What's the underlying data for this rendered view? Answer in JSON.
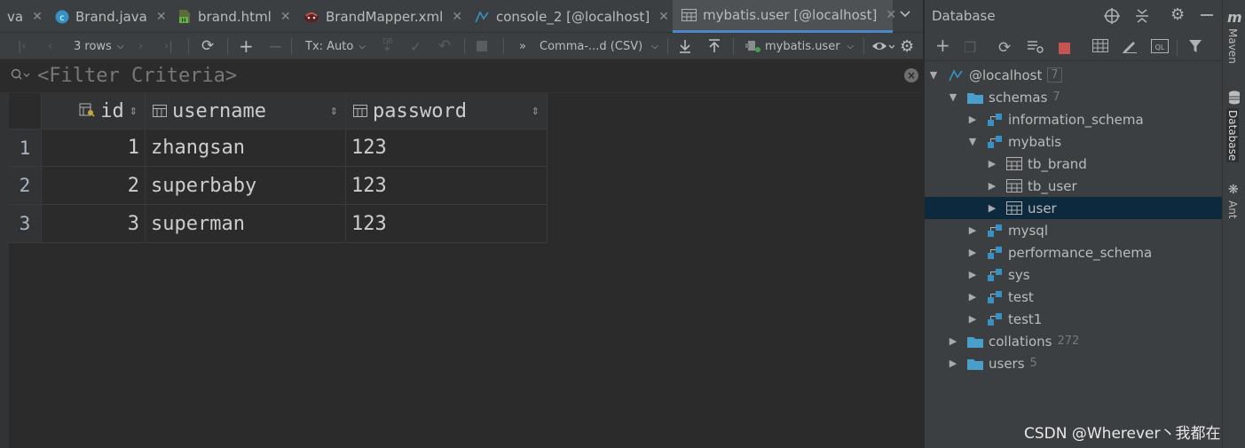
{
  "tabs": [
    {
      "label": "va",
      "icon": "java-class-icon"
    },
    {
      "label": "Brand.java",
      "icon": "java-class-icon"
    },
    {
      "label": "brand.html",
      "icon": "html-file-icon"
    },
    {
      "label": "BrandMapper.xml",
      "icon": "mybatis-xml-icon"
    },
    {
      "label": "console_2 [@localhost]",
      "icon": "sql-console-icon"
    },
    {
      "label": "mybatis.user [@localhost]",
      "icon": "table-icon",
      "active": true
    }
  ],
  "toolbar": {
    "rows": "3 rows",
    "tx": "Tx: Auto",
    "db_label": "DB",
    "export_format": "Comma-...d (CSV)",
    "datasource": "mybatis.user"
  },
  "filter": {
    "placeholder": "<Filter Criteria>"
  },
  "grid": {
    "columns": [
      "id",
      "username",
      "password"
    ],
    "rows": [
      {
        "n": "1",
        "id": "1",
        "username": "zhangsan",
        "password": "123"
      },
      {
        "n": "2",
        "id": "2",
        "username": "superbaby",
        "password": "123"
      },
      {
        "n": "3",
        "id": "3",
        "username": "superman",
        "password": "123"
      }
    ]
  },
  "database_panel": {
    "title": "Database",
    "tree": [
      {
        "label": "@localhost",
        "count": "7",
        "level": 0,
        "expanded": true,
        "icon": "datasource-icon",
        "boxed": true
      },
      {
        "label": "schemas",
        "count": "7",
        "level": 1,
        "expanded": true,
        "icon": "folder-icon"
      },
      {
        "label": "information_schema",
        "level": 2,
        "expanded": false,
        "icon": "schema-icon"
      },
      {
        "label": "mybatis",
        "level": 2,
        "expanded": true,
        "icon": "schema-icon"
      },
      {
        "label": "tb_brand",
        "level": 3,
        "expanded": false,
        "icon": "table-icon"
      },
      {
        "label": "tb_user",
        "level": 3,
        "expanded": false,
        "icon": "table-icon"
      },
      {
        "label": "user",
        "level": 3,
        "expanded": false,
        "icon": "table-icon",
        "selected": true
      },
      {
        "label": "mysql",
        "level": 2,
        "expanded": false,
        "icon": "schema-icon"
      },
      {
        "label": "performance_schema",
        "level": 2,
        "expanded": false,
        "icon": "schema-icon"
      },
      {
        "label": "sys",
        "level": 2,
        "expanded": false,
        "icon": "schema-icon"
      },
      {
        "label": "test",
        "level": 2,
        "expanded": false,
        "icon": "schema-icon"
      },
      {
        "label": "test1",
        "level": 2,
        "expanded": false,
        "icon": "schema-icon"
      },
      {
        "label": "collations",
        "count": "272",
        "level": 1,
        "expanded": false,
        "icon": "folder-icon"
      },
      {
        "label": "users",
        "count": "5",
        "level": 1,
        "expanded": false,
        "icon": "folder-icon"
      }
    ]
  },
  "side_strip": {
    "maven": "Maven",
    "database": "Database",
    "ant": "Ant"
  },
  "watermark": "CSDN @Wherever丶我都在",
  "colors": {
    "accent": "#4a88c7",
    "selection": "#0d293e",
    "folder": "#4a9ecb",
    "schema": "#3592c4",
    "background": "#2b2b2b",
    "panel": "#3c3f41"
  }
}
